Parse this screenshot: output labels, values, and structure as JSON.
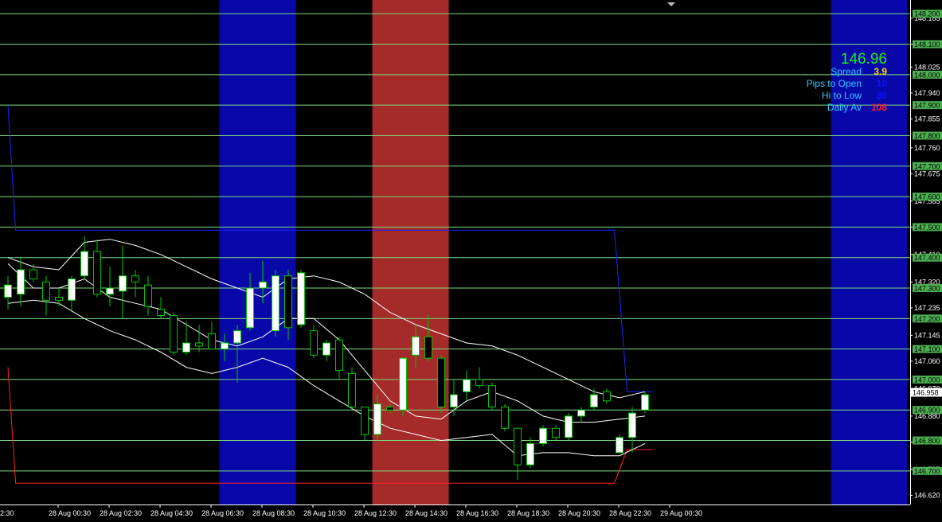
{
  "chart_data": {
    "type": "candlestick",
    "symbol_price": "146.96",
    "info": {
      "spread_label": "Spread",
      "spread_value": "3.9",
      "pips_label": "Pips to Open",
      "pips_value": "10",
      "hilo_label": "Hi to Low",
      "hilo_value": "30",
      "daily_label": "Daily Av",
      "daily_value": "108"
    },
    "colors": {
      "background": "#000000",
      "bull_candle": "#ffffff",
      "bear_candle": "#000000",
      "wick": "#00c800",
      "level_line": "#7cdc7c",
      "band_line": "#ffffff",
      "high_line": "#2020ff",
      "low_line": "#ff2020",
      "session_blue": "#0808a8",
      "session_red": "#a52a2a",
      "axis_text": "#ffffff",
      "level_box": "#4caf50",
      "spread_color": "#ffd700",
      "info_label_color": "#2ec8ff",
      "daily_value_color": "#ff2020",
      "pips_value_color": "#1010ff"
    },
    "y_range": [
      146.59,
      148.245
    ],
    "x_count": 72,
    "price_ticks": [
      "148.185",
      "148.100",
      "148.025",
      "147.940",
      "147.855",
      "147.760",
      "147.675",
      "147.585",
      "147.500",
      "147.410",
      "147.320",
      "147.235",
      "147.145",
      "147.060",
      "146.970",
      "146.880",
      "146.795",
      "146.705",
      "146.620"
    ],
    "level_lines": [
      "148.200",
      "148.100",
      "148.000",
      "147.900",
      "147.800",
      "147.700",
      "147.600",
      "147.500",
      "147.400",
      "147.300",
      "147.200",
      "147.100",
      "147.000",
      "146.900",
      "146.800",
      "146.700"
    ],
    "current_price_label": "146.958",
    "time_labels": [
      {
        "label": "28 Aug 00:30",
        "i": 4
      },
      {
        "label": "28 Aug 02:30",
        "i": 8
      },
      {
        "label": "28 Aug 04:30",
        "i": 12
      },
      {
        "label": "28 Aug 06:30",
        "i": 16
      },
      {
        "label": "28 Aug 08:30",
        "i": 20
      },
      {
        "label": "28 Aug 10:30",
        "i": 24
      },
      {
        "label": "28 Aug 12:30",
        "i": 28
      },
      {
        "label": "28 Aug 14:30",
        "i": 32
      },
      {
        "label": "28 Aug 16:30",
        "i": 36
      },
      {
        "label": "28 Aug 18:30",
        "i": 40
      },
      {
        "label": "28 Aug 20:30",
        "i": 44
      },
      {
        "label": "28 Aug 22:30",
        "i": 48
      },
      {
        "label": "29 Aug 00:30",
        "i": 52
      }
    ],
    "partial_time_label": "2:30",
    "sessions": [
      {
        "color": "blue",
        "from": 16.6,
        "to": 22.6
      },
      {
        "color": "red",
        "from": 28.6,
        "to": 34.6
      },
      {
        "color": "blue",
        "from": 64.6,
        "to": 70.6
      }
    ],
    "day_high_line": [
      [
        0,
        147.9
      ],
      [
        0.6,
        147.49
      ],
      [
        47.6,
        147.49
      ],
      [
        48.6,
        146.96
      ],
      [
        50.6,
        146.96
      ]
    ],
    "day_low_line": [
      [
        0,
        147.04
      ],
      [
        0.6,
        146.66
      ],
      [
        47.6,
        146.66
      ],
      [
        48.6,
        146.77
      ],
      [
        50.6,
        146.77
      ]
    ],
    "band_upper": [
      [
        0,
        147.4
      ],
      [
        2,
        147.37
      ],
      [
        4,
        147.36
      ],
      [
        6,
        147.45
      ],
      [
        8,
        147.46
      ],
      [
        10,
        147.44
      ],
      [
        12,
        147.41
      ],
      [
        14,
        147.37
      ],
      [
        16,
        147.33
      ],
      [
        18,
        147.3
      ],
      [
        20,
        147.27
      ],
      [
        22,
        147.33
      ],
      [
        24,
        147.34
      ],
      [
        26,
        147.32
      ],
      [
        28,
        147.28
      ],
      [
        30,
        147.22
      ],
      [
        32,
        147.18
      ],
      [
        34,
        147.15
      ],
      [
        36,
        147.12
      ],
      [
        38,
        147.11
      ],
      [
        40,
        147.08
      ],
      [
        42,
        147.04
      ],
      [
        44,
        147.0
      ],
      [
        46,
        146.96
      ],
      [
        48,
        146.94
      ],
      [
        50,
        146.96
      ]
    ],
    "band_mid": [
      [
        0,
        147.38
      ],
      [
        2,
        147.3
      ],
      [
        4,
        147.3
      ],
      [
        6,
        147.33
      ],
      [
        8,
        147.27
      ],
      [
        10,
        147.25
      ],
      [
        12,
        147.23
      ],
      [
        14,
        147.18
      ],
      [
        16,
        147.13
      ],
      [
        18,
        147.11
      ],
      [
        20,
        147.14
      ],
      [
        22,
        147.2
      ],
      [
        24,
        147.2
      ],
      [
        26,
        147.13
      ],
      [
        28,
        147.03
      ],
      [
        30,
        146.93
      ],
      [
        32,
        146.88
      ],
      [
        34,
        146.87
      ],
      [
        36,
        146.93
      ],
      [
        38,
        146.96
      ],
      [
        40,
        146.93
      ],
      [
        42,
        146.88
      ],
      [
        44,
        146.86
      ],
      [
        46,
        146.86
      ],
      [
        48,
        146.87
      ],
      [
        50,
        146.88
      ]
    ],
    "band_lower": [
      [
        0,
        147.25
      ],
      [
        2,
        147.26
      ],
      [
        4,
        147.25
      ],
      [
        6,
        147.2
      ],
      [
        8,
        147.16
      ],
      [
        10,
        147.13
      ],
      [
        12,
        147.09
      ],
      [
        14,
        147.04
      ],
      [
        16,
        147.02
      ],
      [
        18,
        147.04
      ],
      [
        20,
        147.07
      ],
      [
        22,
        147.04
      ],
      [
        24,
        146.98
      ],
      [
        26,
        146.93
      ],
      [
        28,
        146.88
      ],
      [
        30,
        146.84
      ],
      [
        32,
        146.82
      ],
      [
        34,
        146.8
      ],
      [
        36,
        146.81
      ],
      [
        38,
        146.82
      ],
      [
        40,
        146.75
      ],
      [
        42,
        146.76
      ],
      [
        44,
        146.76
      ],
      [
        46,
        146.75
      ],
      [
        48,
        146.75
      ],
      [
        50,
        146.79
      ]
    ],
    "candles": [
      {
        "i": 0,
        "o": 147.27,
        "h": 147.34,
        "l": 147.23,
        "c": 147.31
      },
      {
        "i": 1,
        "o": 147.28,
        "h": 147.4,
        "l": 147.24,
        "c": 147.36
      },
      {
        "i": 2,
        "o": 147.36,
        "h": 147.38,
        "l": 147.32,
        "c": 147.33
      },
      {
        "i": 3,
        "o": 147.32,
        "h": 147.34,
        "l": 147.21,
        "c": 147.26
      },
      {
        "i": 4,
        "o": 147.27,
        "h": 147.3,
        "l": 147.24,
        "c": 147.26
      },
      {
        "i": 5,
        "o": 147.26,
        "h": 147.34,
        "l": 147.22,
        "c": 147.33
      },
      {
        "i": 6,
        "o": 147.34,
        "h": 147.47,
        "l": 147.33,
        "c": 147.42
      },
      {
        "i": 7,
        "o": 147.42,
        "h": 147.46,
        "l": 147.27,
        "c": 147.28
      },
      {
        "i": 8,
        "o": 147.28,
        "h": 147.37,
        "l": 147.24,
        "c": 147.3
      },
      {
        "i": 9,
        "o": 147.29,
        "h": 147.44,
        "l": 147.2,
        "c": 147.34
      },
      {
        "i": 10,
        "o": 147.34,
        "h": 147.36,
        "l": 147.27,
        "c": 147.32
      },
      {
        "i": 11,
        "o": 147.31,
        "h": 147.34,
        "l": 147.21,
        "c": 147.24
      },
      {
        "i": 12,
        "o": 147.23,
        "h": 147.27,
        "l": 147.2,
        "c": 147.21
      },
      {
        "i": 13,
        "o": 147.21,
        "h": 147.22,
        "l": 147.08,
        "c": 147.09
      },
      {
        "i": 14,
        "o": 147.09,
        "h": 147.19,
        "l": 147.08,
        "c": 147.12
      },
      {
        "i": 15,
        "o": 147.12,
        "h": 147.18,
        "l": 147.09,
        "c": 147.11
      },
      {
        "i": 16,
        "o": 147.15,
        "h": 147.19,
        "l": 147.1,
        "c": 147.1
      },
      {
        "i": 17,
        "o": 147.1,
        "h": 147.15,
        "l": 147.06,
        "c": 147.12
      },
      {
        "i": 18,
        "o": 147.12,
        "h": 147.18,
        "l": 146.99,
        "c": 147.16
      },
      {
        "i": 19,
        "o": 147.17,
        "h": 147.35,
        "l": 147.16,
        "c": 147.3
      },
      {
        "i": 20,
        "o": 147.3,
        "h": 147.39,
        "l": 147.25,
        "c": 147.32
      },
      {
        "i": 21,
        "o": 147.16,
        "h": 147.36,
        "l": 147.14,
        "c": 147.34
      },
      {
        "i": 22,
        "o": 147.34,
        "h": 147.36,
        "l": 147.13,
        "c": 147.17
      },
      {
        "i": 23,
        "o": 147.18,
        "h": 147.36,
        "l": 147.17,
        "c": 147.35
      },
      {
        "i": 24,
        "o": 147.16,
        "h": 147.18,
        "l": 147.07,
        "c": 147.08
      },
      {
        "i": 25,
        "o": 147.08,
        "h": 147.13,
        "l": 147.06,
        "c": 147.12
      },
      {
        "i": 26,
        "o": 147.13,
        "h": 147.14,
        "l": 147.0,
        "c": 147.03
      },
      {
        "i": 27,
        "o": 147.02,
        "h": 147.04,
        "l": 146.9,
        "c": 146.91
      },
      {
        "i": 28,
        "o": 146.91,
        "h": 146.91,
        "l": 146.8,
        "c": 146.82
      },
      {
        "i": 29,
        "o": 146.82,
        "h": 146.95,
        "l": 146.8,
        "c": 146.92
      },
      {
        "i": 30,
        "o": 146.91,
        "h": 146.92,
        "l": 146.89,
        "c": 146.9
      },
      {
        "i": 31,
        "o": 146.9,
        "h": 147.07,
        "l": 146.88,
        "c": 147.07
      },
      {
        "i": 32,
        "o": 147.08,
        "h": 147.18,
        "l": 147.04,
        "c": 147.14
      },
      {
        "i": 33,
        "o": 147.14,
        "h": 147.21,
        "l": 147.06,
        "c": 147.07
      },
      {
        "i": 34,
        "o": 147.07,
        "h": 147.08,
        "l": 146.89,
        "c": 146.91
      },
      {
        "i": 35,
        "o": 146.91,
        "h": 147.0,
        "l": 146.88,
        "c": 146.95
      },
      {
        "i": 36,
        "o": 146.96,
        "h": 147.03,
        "l": 146.93,
        "c": 147.0
      },
      {
        "i": 37,
        "o": 147.0,
        "h": 147.04,
        "l": 146.97,
        "c": 146.98
      },
      {
        "i": 38,
        "o": 146.98,
        "h": 146.99,
        "l": 146.9,
        "c": 146.91
      },
      {
        "i": 39,
        "o": 146.91,
        "h": 146.92,
        "l": 146.83,
        "c": 146.84
      },
      {
        "i": 40,
        "o": 146.84,
        "h": 146.84,
        "l": 146.67,
        "c": 146.72
      },
      {
        "i": 41,
        "o": 146.72,
        "h": 146.81,
        "l": 146.71,
        "c": 146.79
      },
      {
        "i": 42,
        "o": 146.79,
        "h": 146.85,
        "l": 146.78,
        "c": 146.84
      },
      {
        "i": 43,
        "o": 146.84,
        "h": 146.85,
        "l": 146.8,
        "c": 146.81
      },
      {
        "i": 44,
        "o": 146.81,
        "h": 146.89,
        "l": 146.8,
        "c": 146.88
      },
      {
        "i": 45,
        "o": 146.88,
        "h": 146.91,
        "l": 146.86,
        "c": 146.9
      },
      {
        "i": 46,
        "o": 146.91,
        "h": 146.97,
        "l": 146.9,
        "c": 146.95
      },
      {
        "i": 47,
        "o": 146.96,
        "h": 146.97,
        "l": 146.92,
        "c": 146.93
      },
      {
        "i": 48,
        "o": 146.76,
        "h": 146.82,
        "l": 146.76,
        "c": 146.81
      },
      {
        "i": 49,
        "o": 146.81,
        "h": 146.91,
        "l": 146.76,
        "c": 146.89
      },
      {
        "i": 50,
        "o": 146.9,
        "h": 146.96,
        "l": 146.89,
        "c": 146.95
      }
    ]
  }
}
